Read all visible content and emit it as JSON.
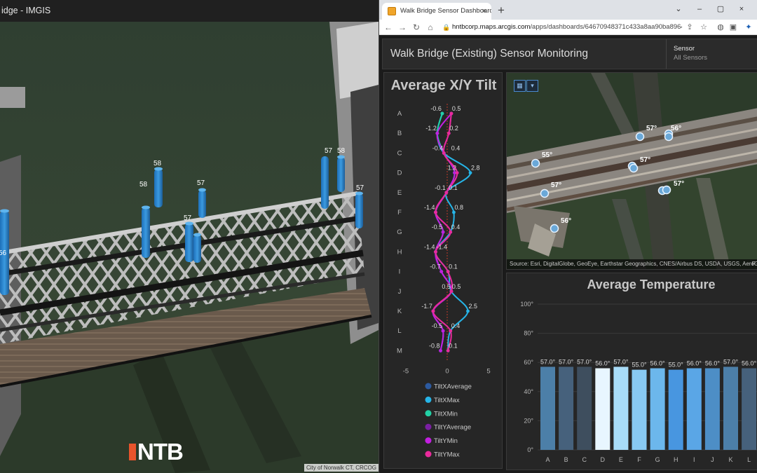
{
  "left_window": {
    "title": "idge - IMGIS",
    "bar_labels": [
      "58",
      "58",
      "57",
      "57",
      "57",
      "58",
      "57",
      "56"
    ],
    "logo_text": "NTB",
    "attribution": "City of Norwalk CT, CRCOG"
  },
  "browser": {
    "tab_title": "Walk Bridge Sensor Dashboard",
    "tab_close": "×",
    "new_tab": "+",
    "min": "–",
    "max": "▢",
    "close": "×",
    "url_host": "hntbcorp.maps.arcgis.com",
    "url_path": "/apps/dashboards/64670948371c433a8aa90ba896498..."
  },
  "dashboard": {
    "title": "Walk Bridge (Existing) Sensor Monitoring",
    "sensor_label": "Sensor",
    "sensor_value": "All Sensors"
  },
  "map": {
    "pin_labels": [
      "57°",
      "56°",
      "55°",
      "57°",
      "57°",
      "57°",
      "56°"
    ],
    "attribution": "Source: Esri, DigitalGlobe, GeoEye, Earthstar Geographics, CNES/Airbus DS, USDA, USGS, AeroG...",
    "attribution_right": "P"
  },
  "chart_data": [
    {
      "type": "line",
      "title": "Average X/Y Tilt",
      "orientation": "horizontal",
      "categories": [
        "A",
        "B",
        "C",
        "D",
        "E",
        "F",
        "G",
        "H",
        "I",
        "J",
        "K",
        "L",
        "M"
      ],
      "xlim": [
        -5,
        5
      ],
      "x_ticks": [
        "-5",
        "0",
        "5"
      ],
      "series": [
        {
          "name": "TiltXAverage",
          "color": "#2c5aa0",
          "values": [
            -0.6,
            -1.2,
            -0.4,
            0.9,
            -0.1,
            -1.4,
            -0.5,
            -1.4,
            -0.7,
            0.5,
            -1.7,
            -0.5,
            -0.8
          ]
        },
        {
          "name": "TiltXMax",
          "color": "#26b5e8",
          "values": [
            -0.6,
            -1.2,
            -0.4,
            2.8,
            -0.1,
            0.8,
            0.4,
            -1.4,
            0.1,
            0.5,
            2.5,
            0.4,
            0.1
          ]
        },
        {
          "name": "TiltXMin",
          "color": "#22d1a6",
          "values": [
            -0.6,
            -1.2,
            -0.4,
            0.9,
            -0.1,
            -1.4,
            -0.5,
            -1.4,
            -0.7,
            0.5,
            -1.7,
            -0.5,
            -0.8
          ]
        },
        {
          "name": "TiltYAverage",
          "color": "#7a1fa2",
          "values": [
            0.5,
            0.2,
            -0.4,
            1.2,
            -0.1,
            -1.4,
            0.4,
            -1.4,
            -0.7,
            0.5,
            -1.7,
            -0.5,
            -0.8
          ]
        },
        {
          "name": "TiltYMin",
          "color": "#c21fe0",
          "values": [
            0.5,
            -1.2,
            -0.4,
            0.9,
            -0.1,
            -1.4,
            -0.5,
            -1.4,
            -0.7,
            0.5,
            -1.7,
            -0.5,
            -0.8
          ]
        },
        {
          "name": "TiltYMax",
          "color": "#ea2a9c",
          "values": [
            0.5,
            0.2,
            -0.4,
            1.2,
            -0.1,
            -1.4,
            0.4,
            -1.4,
            0.1,
            0.5,
            -1.7,
            0.4,
            0.1
          ]
        }
      ],
      "data_labels": [
        [
          "-0.6",
          "0.5"
        ],
        [
          "-1.2",
          "0.2"
        ],
        [
          "-0.4",
          "0.4"
        ],
        [
          "1.2",
          "2.8"
        ],
        [
          "-0.1",
          "0.1"
        ],
        [
          "-1.4",
          "0.8"
        ],
        [
          "-0.5",
          "0.4"
        ],
        [
          "-1.4",
          "-1.4"
        ],
        [
          "-0.7",
          "0.1"
        ],
        [
          "0.5",
          "0.5"
        ],
        [
          "-1.7",
          "2.5"
        ],
        [
          "-0.5",
          "0.4"
        ],
        [
          "-0.8",
          "0.1"
        ]
      ],
      "legend_position": "bottom",
      "zero_line_color": "#c0392b"
    },
    {
      "type": "bar",
      "title": "Average Temperature",
      "categories": [
        "A",
        "B",
        "C",
        "D",
        "E",
        "F",
        "G",
        "H",
        "I",
        "J",
        "K",
        "L"
      ],
      "values": [
        57.0,
        57.0,
        57.0,
        56.0,
        57.0,
        55.0,
        56.0,
        55.0,
        56.0,
        56.0,
        57.0,
        56.0
      ],
      "value_labels": [
        "57.0°",
        "57.0°",
        "57.0°",
        "56.0°",
        "57.0°",
        "55.0°",
        "56.0°",
        "55.0°",
        "56.0°",
        "56.0°",
        "57.0°",
        "56.0°"
      ],
      "colors": [
        "#4c7fa8",
        "#46617c",
        "#3e4e5e",
        "#e8f6ff",
        "#a8dcf8",
        "#88c9f2",
        "#6cb7ec",
        "#4896e0",
        "#5aa6e6",
        "#4d8ec6",
        "#4c7fa8",
        "#46617c"
      ],
      "ylim": [
        0,
        100
      ],
      "y_ticks": [
        "0°",
        "20°",
        "40°",
        "60°",
        "80°",
        "100°"
      ],
      "grid": true
    }
  ]
}
